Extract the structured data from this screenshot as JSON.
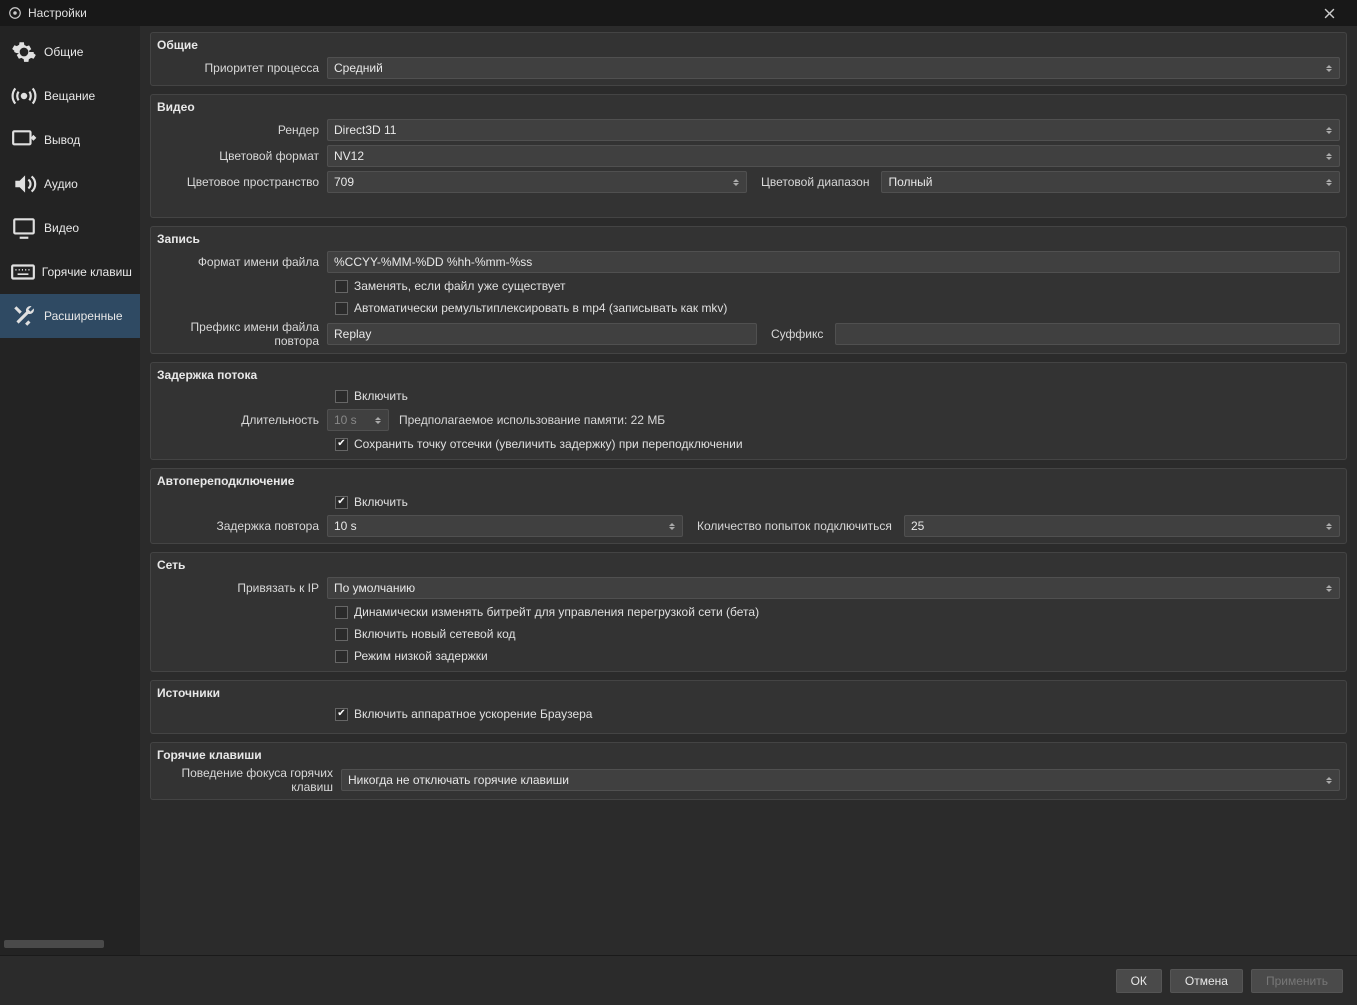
{
  "window": {
    "title": "Настройки"
  },
  "sidebar": {
    "items": [
      {
        "label": "Общие"
      },
      {
        "label": "Вещание"
      },
      {
        "label": "Вывод"
      },
      {
        "label": "Аудио"
      },
      {
        "label": "Видео"
      },
      {
        "label": "Горячие клавиши"
      },
      {
        "label": "Расширенные"
      }
    ]
  },
  "groups": {
    "general": {
      "title": "Общие",
      "process_priority_label": "Приоритет процесса",
      "process_priority_value": "Средний"
    },
    "video": {
      "title": "Видео",
      "renderer_label": "Рендер",
      "renderer_value": "Direct3D 11",
      "color_format_label": "Цветовой формат",
      "color_format_value": "NV12",
      "color_space_label": "Цветовое пространство",
      "color_space_value": "709",
      "color_range_label": "Цветовой диапазон",
      "color_range_value": "Полный"
    },
    "recording": {
      "title": "Запись",
      "filename_format_label": "Формат имени файла",
      "filename_format_value": "%CCYY-%MM-%DD %hh-%mm-%ss",
      "overwrite_label": "Заменять, если файл уже существует",
      "remux_label": "Автоматически ремультиплексировать в mp4 (записывать как mkv)",
      "replay_prefix_label": "Префикс имени файла повтора",
      "replay_prefix_value": "Replay",
      "suffix_label": "Суффикс",
      "suffix_value": ""
    },
    "delay": {
      "title": "Задержка потока",
      "enable_label": "Включить",
      "duration_label": "Длительность",
      "duration_value": "10 s",
      "memory_label": "Предполагаемое использование памяти: 22 МБ",
      "preserve_label": "Сохранить точку отсечки (увеличить задержку) при переподключении"
    },
    "reconnect": {
      "title": "Автопереподключение",
      "enable_label": "Включить",
      "retry_delay_label": "Задержка повтора",
      "retry_delay_value": "10 s",
      "max_retries_label": "Количество попыток подключиться",
      "max_retries_value": "25"
    },
    "network": {
      "title": "Сеть",
      "bind_ip_label": "Привязать к IP",
      "bind_ip_value": "По умолчанию",
      "dynamic_bitrate_label": "Динамически изменять битрейт для управления перегрузкой сети (бета)",
      "new_net_label": "Включить новый сетевой код",
      "low_latency_label": "Режим низкой задержки"
    },
    "sources": {
      "title": "Источники",
      "browser_hw_label": "Включить аппаратное ускорение Браузера"
    },
    "hotkeys": {
      "title": "Горячие клавиши",
      "focus_label": "Поведение фокуса горячих клавиш",
      "focus_value": "Никогда не отключать горячие клавиши"
    }
  },
  "footer": {
    "ok": "ОК",
    "cancel": "Отмена",
    "apply": "Применить"
  }
}
